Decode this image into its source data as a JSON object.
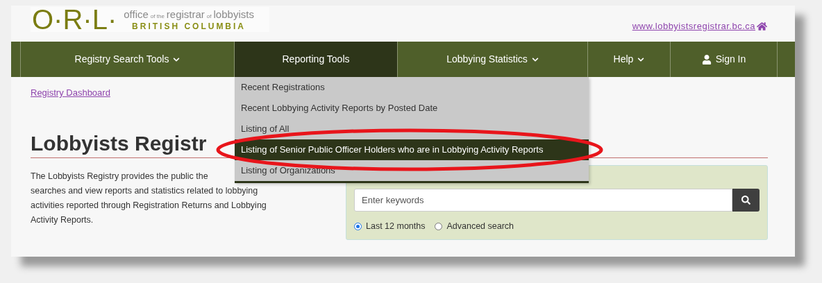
{
  "logo": {
    "initials": "O·R·L·",
    "tagline": [
      {
        "text": "office",
        "kind": "large"
      },
      {
        "text": "of the",
        "kind": "small"
      },
      {
        "text": "registrar",
        "kind": "large"
      },
      {
        "text": "of",
        "kind": "small"
      },
      {
        "text": "lobbyists",
        "kind": "large"
      }
    ],
    "region": "BRITISH COLUMBIA"
  },
  "site_link": "www.lobbyistsregistrar.bc.ca",
  "nav": [
    {
      "label": "Registry Search Tools",
      "kind": "dropdown",
      "selected": false
    },
    {
      "label": "Reporting Tools",
      "kind": "plain",
      "selected": true
    },
    {
      "label": "Lobbying Statistics",
      "kind": "dropdown",
      "selected": false
    },
    {
      "label": "Help",
      "kind": "dropdown",
      "selected": false
    },
    {
      "label": "Sign In",
      "kind": "account",
      "selected": false
    }
  ],
  "menu": [
    {
      "label": "Recent Registrations",
      "selected": false
    },
    {
      "label": "Recent Lobbying Activity Reports by Posted Date",
      "selected": false
    },
    {
      "label": "Listing of All",
      "selected": false
    },
    {
      "label": "Listing of Senior Public Officer Holders who are in Lobbying Activity Reports",
      "selected": true
    },
    {
      "label": "Listing of Organizations",
      "selected": false
    }
  ],
  "breadcrumb": "Registry Dashboard",
  "heading": "Lobbyists Registr",
  "intro_lines": [
    "The Lobbyists Registry provides the public the",
    "searches and view reports and statistics related to lobbying",
    "activities reported through Registration Returns and Lobbying",
    "Activity Reports."
  ],
  "search": {
    "placeholder": "Enter keywords",
    "options": [
      {
        "label": "Last 12 months",
        "selected": true
      },
      {
        "label": "Advanced search",
        "selected": false
      }
    ]
  }
}
